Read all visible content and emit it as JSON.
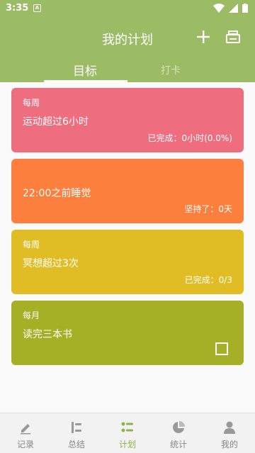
{
  "status_bar": {
    "time": "3:35",
    "notification_icon": "A"
  },
  "header": {
    "title": "我的计划",
    "add_icon": "plus-icon",
    "print_icon": "print-icon"
  },
  "tabs": [
    {
      "label": "目标",
      "active": true
    },
    {
      "label": "打卡",
      "active": false
    }
  ],
  "colors": {
    "header": "#9bbb64",
    "accent": "#8ab34a"
  },
  "cards": [
    {
      "period": "每周",
      "name": "运动超过6小时",
      "status": "已完成：0小时(0.0%)",
      "color": "#ee6e80"
    },
    {
      "period": "",
      "name": "22:00之前睡觉",
      "status": "坚持了：0天",
      "color": "#fd7f3e"
    },
    {
      "period": "每周",
      "name": "冥想超过3次",
      "status": "已完成：0/3",
      "color": "#e0bd24"
    },
    {
      "period": "每月",
      "name": "读完三本书",
      "status": "",
      "color": "#a6b026",
      "checkbox": false
    }
  ],
  "bottom_nav": [
    {
      "label": "记录",
      "icon": "pen-icon"
    },
    {
      "label": "总结",
      "icon": "summary-icon"
    },
    {
      "label": "计划",
      "icon": "plan-list-icon",
      "active": true
    },
    {
      "label": "统计",
      "icon": "pie-chart-icon"
    },
    {
      "label": "我的",
      "icon": "person-icon"
    }
  ]
}
